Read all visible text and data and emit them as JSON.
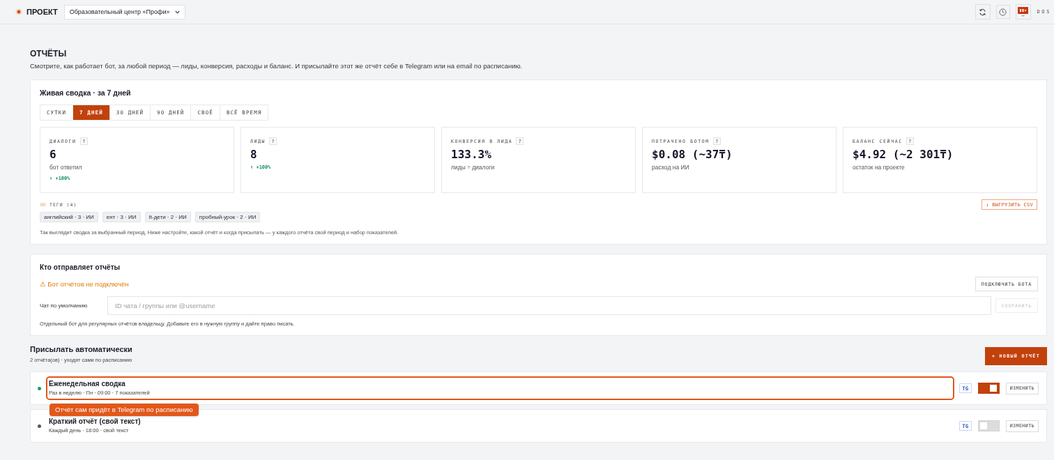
{
  "topbar": {
    "logo": "ПРОЕКТ",
    "project_select": {
      "value": "Образовательный центр «Профи»"
    },
    "user": "DOS"
  },
  "page": {
    "title": "ОТЧЁТЫ",
    "description": "Смотрите, как работает бот, за любой период — лиды, конверсия, расходы и баланс. И присылайте этот же отчёт себе в Telegram или на email по расписанию."
  },
  "summary": {
    "title": "Живая сводка · за 7 дней",
    "periods": [
      {
        "label": "СУТКИ",
        "selected": false
      },
      {
        "label": "7 ДНЕЙ",
        "selected": true
      },
      {
        "label": "30 ДНЕЙ",
        "selected": false
      },
      {
        "label": "90 ДНЕЙ",
        "selected": false
      },
      {
        "label": "СВОЁ",
        "selected": false
      },
      {
        "label": "ВСЁ ВРЕМЯ",
        "selected": false
      }
    ],
    "metrics": [
      {
        "label": "ДИАЛОГИ",
        "help": "?",
        "value": "6",
        "caption": "бот ответил",
        "delta": "↑ +100%"
      },
      {
        "label": "ЛИДЫ",
        "help": "?",
        "value": "8",
        "delta": "↑ +100%"
      },
      {
        "label": "КОНВЕРСИЯ В ЛИДА",
        "help": "?",
        "value": "133.3%",
        "caption": "лиды ÷ диалоги"
      },
      {
        "label": "ПОТРАЧЕНО БОТОМ",
        "help": "?",
        "value": "$0.08 (~37₸)",
        "caption": "расход на ИИ"
      },
      {
        "label": "БАЛАНС СЕЙЧАС",
        "help": "?",
        "value": "$4.92 (~2 301₸)",
        "caption": "остаток на проекте"
      }
    ],
    "tags": {
      "label": "ТЕГИ (4)",
      "items": [
        "английский · 3 · ИИ",
        "ент · 3 · ИИ",
        "It-дети · 2 · ИИ",
        "пробный-урок · 2 · ИИ"
      ]
    },
    "export_button": "↓ ВЫГРУЗИТЬ CSV",
    "note": "Так выглядит сводка за выбранный период. Ниже настройте, какой отчёт и когда присылать — у каждого отчёта свой период и набор показателей."
  },
  "sender": {
    "title": "Кто отправляет отчёты",
    "warning": "⚠ Бот отчётов не подключён",
    "connect_button": "ПОДКЛЮЧИТЬ БОТА",
    "chat_field": {
      "label": "Чат по умолчанию",
      "placeholder": "ID чата / группы или @username"
    },
    "save_button": {
      "label": "СОХРАНИТЬ",
      "disabled": true
    },
    "note": "Отдельный бот для регулярных отчётов владельцу. Добавьте его в нужную группу и дайте право писать."
  },
  "schedule": {
    "title": "Присылать автоматически",
    "subtitle": "2 отчёта(ов) · уходят сами по расписанию",
    "new_button": "+ НОВЫЙ ОТЧЁТ",
    "reports": [
      {
        "title": "Еженедельная сводка",
        "details": "Раз в неделю · Пн · 09:00 · 7 показателей",
        "color": "#10a36b",
        "channel": "TG",
        "on": true,
        "highlighted": true,
        "tooltip": "Отчёт сам придёт в Telegram по расписанию",
        "edit_button": "ИЗМЕНИТЬ"
      },
      {
        "title": "Краткий отчёт (свой текст)",
        "details": "Каждый день · 18:00 · свой текст",
        "color": "#55585f",
        "channel": "TG",
        "on": false,
        "highlighted": false,
        "edit_button": "ИЗМЕНИТЬ"
      }
    ]
  }
}
